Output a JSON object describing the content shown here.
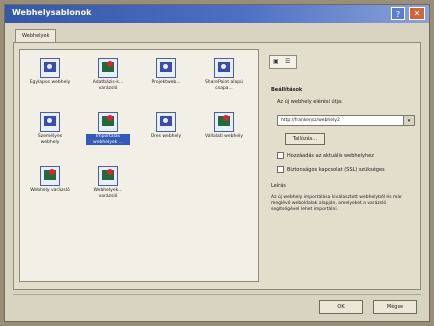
{
  "window": {
    "title": "Webhelysablonok"
  },
  "tabs": [
    {
      "label": "Webhelyek"
    }
  ],
  "templates": [
    {
      "label": "Egylapos webhely",
      "icon": "web-page-icon"
    },
    {
      "label": "Adatbázis-k... varázsló",
      "icon": "wizard-icon"
    },
    {
      "label": "Projektweb...",
      "icon": "web-page-icon"
    },
    {
      "label": "SharePoint alapú csapa...",
      "icon": "web-page-icon"
    },
    {
      "label": "Személyes webhely",
      "icon": "web-page-icon"
    },
    {
      "label": "Importálás webhelyek ...",
      "icon": "wizard-icon"
    },
    {
      "label": "Üres webhely",
      "icon": "web-page-icon"
    },
    {
      "label": "Vállalati webhely",
      "icon": "wizard-icon"
    },
    {
      "label": "Webhely varázsló",
      "icon": "wizard-icon"
    },
    {
      "label": "Webhelyek... varázsló",
      "icon": "wizard-icon"
    }
  ],
  "options": {
    "section_title": "Beállítások",
    "location_label": "Az új webhely elérési útja:",
    "location_value": "http://frankensz/webhely2",
    "browse_label": "Tallózás...",
    "add_to_current_label": "Hozzáadás az aktuális webhelyhez",
    "ssl_label": "Biztonságos kapcsolat (SSL) szükséges"
  },
  "description": {
    "title": "Leírás",
    "text": "Az új webhely importálása kiválasztott webhelyből és már meglévő weboldalak alapján, amelyeket a varázsló segítségével lehet importálni."
  },
  "footer": {
    "ok_label": "OK",
    "cancel_label": "Mégse"
  }
}
